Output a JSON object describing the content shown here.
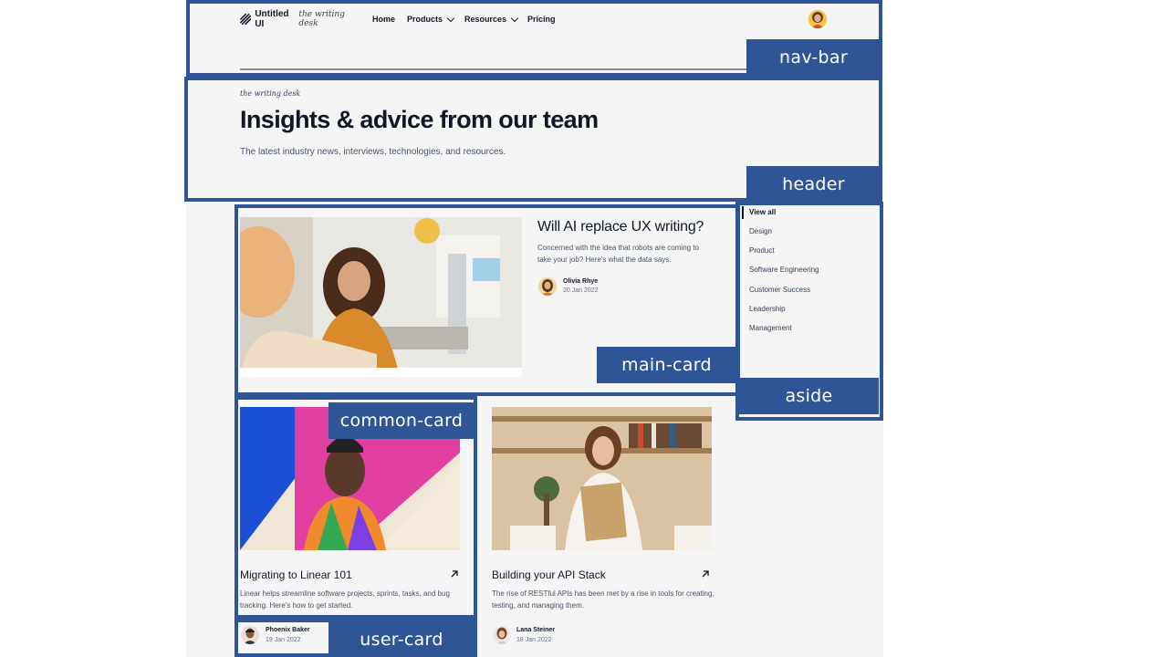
{
  "nav": {
    "brand": "Untitled UI",
    "brand_script": "the writing desk",
    "links": [
      {
        "label": "Home"
      },
      {
        "label": "Products"
      },
      {
        "label": "Resources"
      },
      {
        "label": "Pricing"
      }
    ]
  },
  "header": {
    "eyebrow": "the writing desk",
    "title": "Insights & advice from our team",
    "subtitle": "The latest industry news, interviews, technologies, and resources."
  },
  "main_card": {
    "title": "Will AI replace UX writing?",
    "description": "Concerned with the idea that robots are coming to take your job? Here's what the data says.",
    "author": "Olivia Rhye",
    "date": "20 Jan 2022"
  },
  "aside": {
    "items": [
      {
        "label": "View all",
        "active": true
      },
      {
        "label": "Design"
      },
      {
        "label": "Product"
      },
      {
        "label": "Software Engineering"
      },
      {
        "label": "Customer Success"
      },
      {
        "label": "Leadership"
      },
      {
        "label": "Management"
      }
    ]
  },
  "cards": [
    {
      "title": "Migrating to Linear 101",
      "description": "Linear helps streamline software projects, sprints, tasks, and bug tracking. Here's how to get started.",
      "author": "Phoenix Baker",
      "date": "19 Jan 2022"
    },
    {
      "title": "Building your API Stack",
      "description": "The rise of RESTful APIs has been met by a rise in tools for creating, testing, and managing them.",
      "author": "Lana Steiner",
      "date": "18 Jan 2022"
    }
  ],
  "annotations": {
    "nav_bar": "nav-bar",
    "header": "header",
    "main_card": "main-card",
    "aside": "aside",
    "common_card": "common-card",
    "user_card": "user-card"
  },
  "colors": {
    "annotation": "#2f5597",
    "page_bg": "#f5f5f5",
    "text_primary": "#101828",
    "text_secondary": "#475467"
  }
}
